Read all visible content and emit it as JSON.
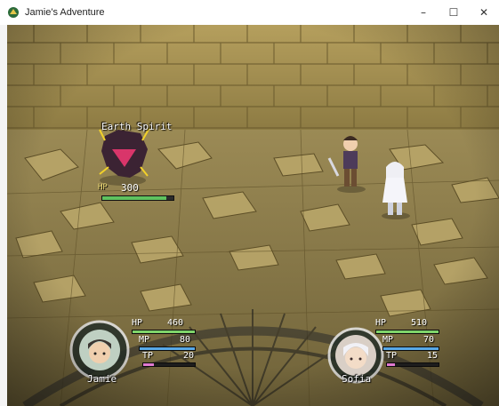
{
  "window": {
    "title": "Jamie's Adventure",
    "minimize_glyph": "–",
    "maximize_glyph": "☐",
    "close_glyph": "✕"
  },
  "enemy": {
    "name": "Earth Spirit",
    "hp_label": "HP",
    "hp_value": "300",
    "hp_fraction": 0.9
  },
  "party": [
    {
      "name": "Jamie",
      "hp_label": "HP",
      "hp_value": "460",
      "hp_fraction": 1.0,
      "mp_label": "MP",
      "mp_value": "80",
      "mp_fraction": 1.0,
      "tp_label": "TP",
      "tp_value": "20",
      "tp_fraction": 0.2
    },
    {
      "name": "Sofia",
      "hp_label": "HP",
      "hp_value": "510",
      "hp_fraction": 1.0,
      "mp_label": "MP",
      "mp_value": "70",
      "mp_fraction": 1.0,
      "tp_label": "TP",
      "tp_value": "15",
      "tp_fraction": 0.15
    }
  ],
  "colors": {
    "hp_gauge": "#7fd46a",
    "mp_gauge": "#58a8e6",
    "tp_gauge": "#e07ad0",
    "enemy_hp": "#5fc25f"
  },
  "icons": {
    "app": "game-app-icon",
    "minimize": "minimize-icon",
    "maximize": "maximize-icon",
    "close": "close-icon"
  }
}
